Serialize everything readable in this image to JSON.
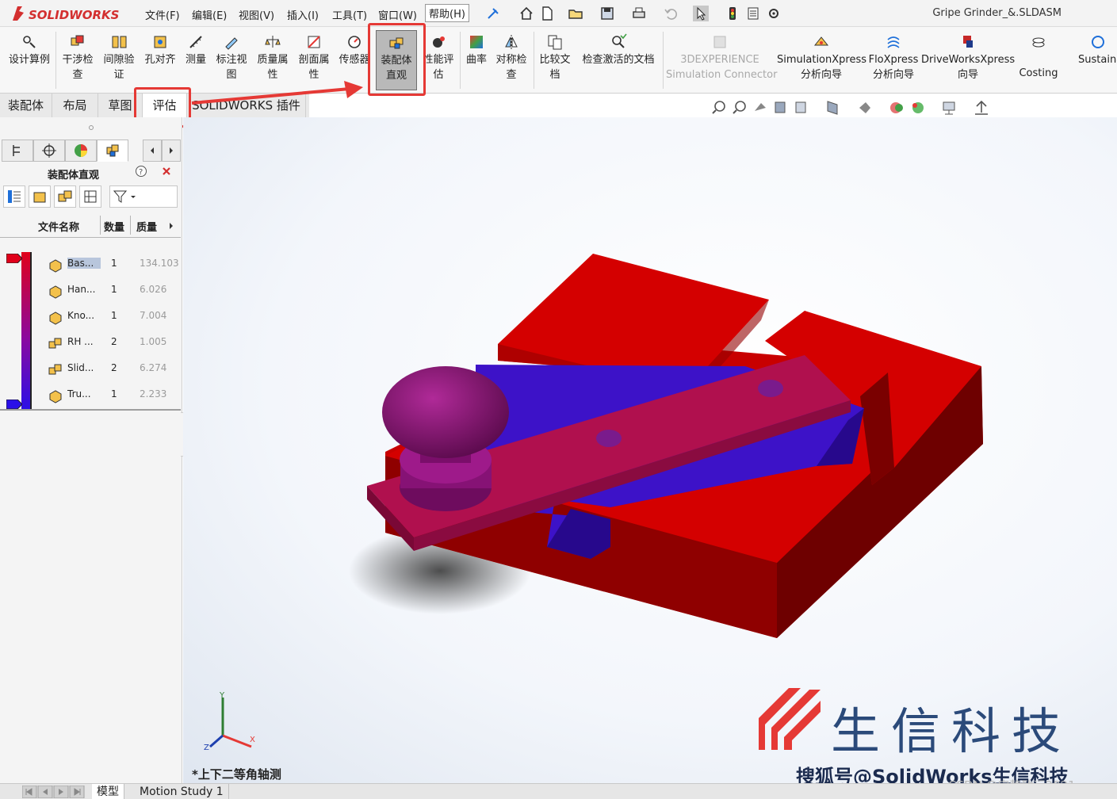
{
  "app": {
    "logo_text": "SOLIDWORKS",
    "document_title": "Gripe Grinder_&.SLDASM"
  },
  "menu": [
    {
      "label": "文件(F)"
    },
    {
      "label": "编辑(E)"
    },
    {
      "label": "视图(V)"
    },
    {
      "label": "插入(I)"
    },
    {
      "label": "工具(T)"
    },
    {
      "label": "窗口(W)"
    },
    {
      "label": "帮助(H)"
    }
  ],
  "ribbon": [
    {
      "label": "设计算例\n",
      "icon": "design-study-icon"
    },
    {
      "label": "干涉检\n查",
      "icon": "interference-icon"
    },
    {
      "label": "间隙验\n证",
      "icon": "clearance-icon"
    },
    {
      "label": "孔对齐",
      "icon": "hole-alignment-icon"
    },
    {
      "label": "测量",
      "icon": "measure-icon"
    },
    {
      "label": "标注视\n图",
      "icon": "markup-icon"
    },
    {
      "label": "质量属\n性",
      "icon": "mass-properties-icon"
    },
    {
      "label": "剖面属\n性",
      "icon": "section-properties-icon"
    },
    {
      "label": "传感器",
      "icon": "sensor-icon"
    },
    {
      "label": "装配体\n直观",
      "icon": "assembly-visualization-icon"
    },
    {
      "label": "性能评\n估",
      "icon": "performance-icon"
    },
    {
      "label": "曲率",
      "icon": "curvature-icon"
    },
    {
      "label": "对称检\n查",
      "icon": "symmetry-icon"
    },
    {
      "label": "比较文\n档",
      "icon": "compare-icon"
    },
    {
      "label": "检查激活的文档",
      "icon": "check-document-icon"
    },
    {
      "label": "3DEXPERIENCE\nSimulation Connector",
      "icon": "3dx-icon"
    },
    {
      "label": "SimulationXpress\n分析向导",
      "icon": "simxpress-icon"
    },
    {
      "label": "FloXpress\n分析向导",
      "icon": "floxpress-icon"
    },
    {
      "label": "DriveWorksXpress\n向导",
      "icon": "driveworks-icon"
    },
    {
      "label": "Costing",
      "icon": "costing-icon"
    },
    {
      "label": "Sustaina",
      "icon": "sustainability-icon"
    }
  ],
  "command_tabs": [
    {
      "label": "装配体"
    },
    {
      "label": "布局"
    },
    {
      "label": "草图"
    },
    {
      "label": "评估"
    },
    {
      "label": "SOLIDWORKS 插件"
    }
  ],
  "panel": {
    "title": "装配体直观",
    "columns": [
      "文件名称",
      "数量",
      "质量"
    ],
    "rows": [
      {
        "name": "Bas...",
        "qty": "1",
        "mass": "134.103"
      },
      {
        "name": "Han...",
        "qty": "1",
        "mass": "6.026"
      },
      {
        "name": "Kno...",
        "qty": "1",
        "mass": "7.004"
      },
      {
        "name": "RH ...",
        "qty": "2",
        "mass": "1.005"
      },
      {
        "name": "Slid...",
        "qty": "2",
        "mass": "6.274"
      },
      {
        "name": "Tru...",
        "qty": "1",
        "mass": "2.233"
      }
    ]
  },
  "viewport": {
    "view_name": "*上下二等角轴测",
    "axis_labels": {
      "x": "X",
      "y": "Y",
      "z": "Z"
    }
  },
  "bottom_tabs": [
    {
      "label": "模型"
    },
    {
      "label": "Motion Study 1"
    }
  ],
  "watermark": {
    "brand": "生信科技",
    "sohu": "搜狐号@SolidWorks生信科技",
    "csdn": "CSDN @宁静致远2021"
  },
  "colors": {
    "highlight": "#e53935",
    "base_red": "#d40000",
    "knob_purple": "#8a1272",
    "slide_blue": "#3d12c8"
  }
}
